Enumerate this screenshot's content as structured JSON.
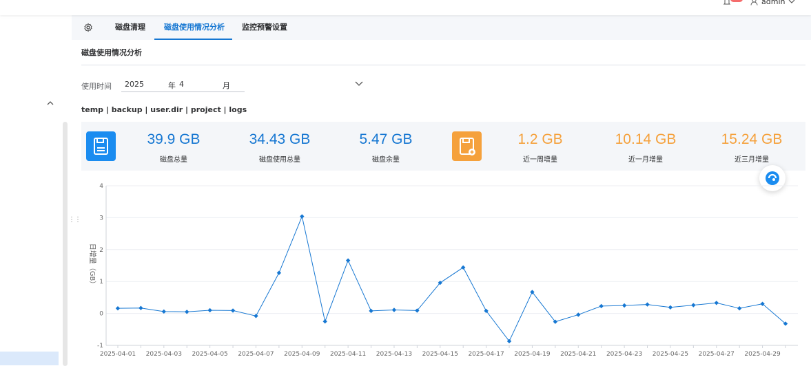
{
  "header": {
    "user_name": "admin",
    "badge_color": "#f56c6c",
    "bell_icon": "bell-icon",
    "user_icon": "user-icon"
  },
  "tabs": [
    {
      "label": "磁盘清理",
      "active": false
    },
    {
      "label": "磁盘使用情况分析",
      "active": true
    },
    {
      "label": "监控预警设置",
      "active": false
    }
  ],
  "section_title": "磁盘使用情况分析",
  "filter": {
    "label": "使用时间",
    "year": "2025",
    "year_unit": "年",
    "month": "4",
    "month_unit": "月"
  },
  "directories": "temp | backup | user.dir | project | logs",
  "stats": [
    {
      "value": "39.9 GB",
      "label": "磁盘总量",
      "color": "#1677d2"
    },
    {
      "value": "34.43 GB",
      "label": "磁盘使用总量",
      "color": "#1677d2"
    },
    {
      "value": "5.47 GB",
      "label": "磁盘余量",
      "color": "#1677d2"
    },
    {
      "value": "1.2 GB",
      "label": "近一周增量",
      "color": "#f5a13c"
    },
    {
      "value": "10.14 GB",
      "label": "近一月增量",
      "color": "#f5a13c"
    },
    {
      "value": "15.24 GB",
      "label": "近三月增量",
      "color": "#f5a13c"
    }
  ],
  "colors": {
    "accent": "#1677d2",
    "warning": "#f5a13c"
  },
  "chart_data": {
    "type": "line",
    "ylabel": "日增量（GB）",
    "ylim": [
      -1,
      4
    ],
    "yticks": [
      -1,
      0,
      1,
      2,
      3,
      4
    ],
    "grid": true,
    "x": [
      "2025-04-01",
      "2025-04-02",
      "2025-04-03",
      "2025-04-04",
      "2025-04-05",
      "2025-04-06",
      "2025-04-07",
      "2025-04-08",
      "2025-04-09",
      "2025-04-10",
      "2025-04-11",
      "2025-04-12",
      "2025-04-13",
      "2025-04-14",
      "2025-04-15",
      "2025-04-16",
      "2025-04-17",
      "2025-04-18",
      "2025-04-19",
      "2025-04-20",
      "2025-04-21",
      "2025-04-22",
      "2025-04-23",
      "2025-04-24",
      "2025-04-25",
      "2025-04-26",
      "2025-04-27",
      "2025-04-28",
      "2025-04-29",
      "2025-04-30"
    ],
    "xtick_labels": [
      "2025-04-01",
      "2025-04-03",
      "2025-04-05",
      "2025-04-07",
      "2025-04-09",
      "2025-04-11",
      "2025-04-13",
      "2025-04-15",
      "2025-04-17",
      "2025-04-19",
      "2025-04-21",
      "2025-04-23",
      "2025-04-25",
      "2025-04-27",
      "2025-04-29"
    ],
    "series": [
      {
        "values": [
          0.16,
          0.17,
          0.06,
          0.05,
          0.1,
          0.09,
          -0.08,
          1.27,
          3.04,
          -0.25,
          1.66,
          0.08,
          0.11,
          0.09,
          0.96,
          1.44,
          0.08,
          -0.87,
          0.67,
          -0.26,
          -0.04,
          0.23,
          0.25,
          0.28,
          0.19,
          0.26,
          0.33,
          0.16,
          0.3,
          -0.32
        ],
        "color": "#1677d2"
      }
    ]
  }
}
